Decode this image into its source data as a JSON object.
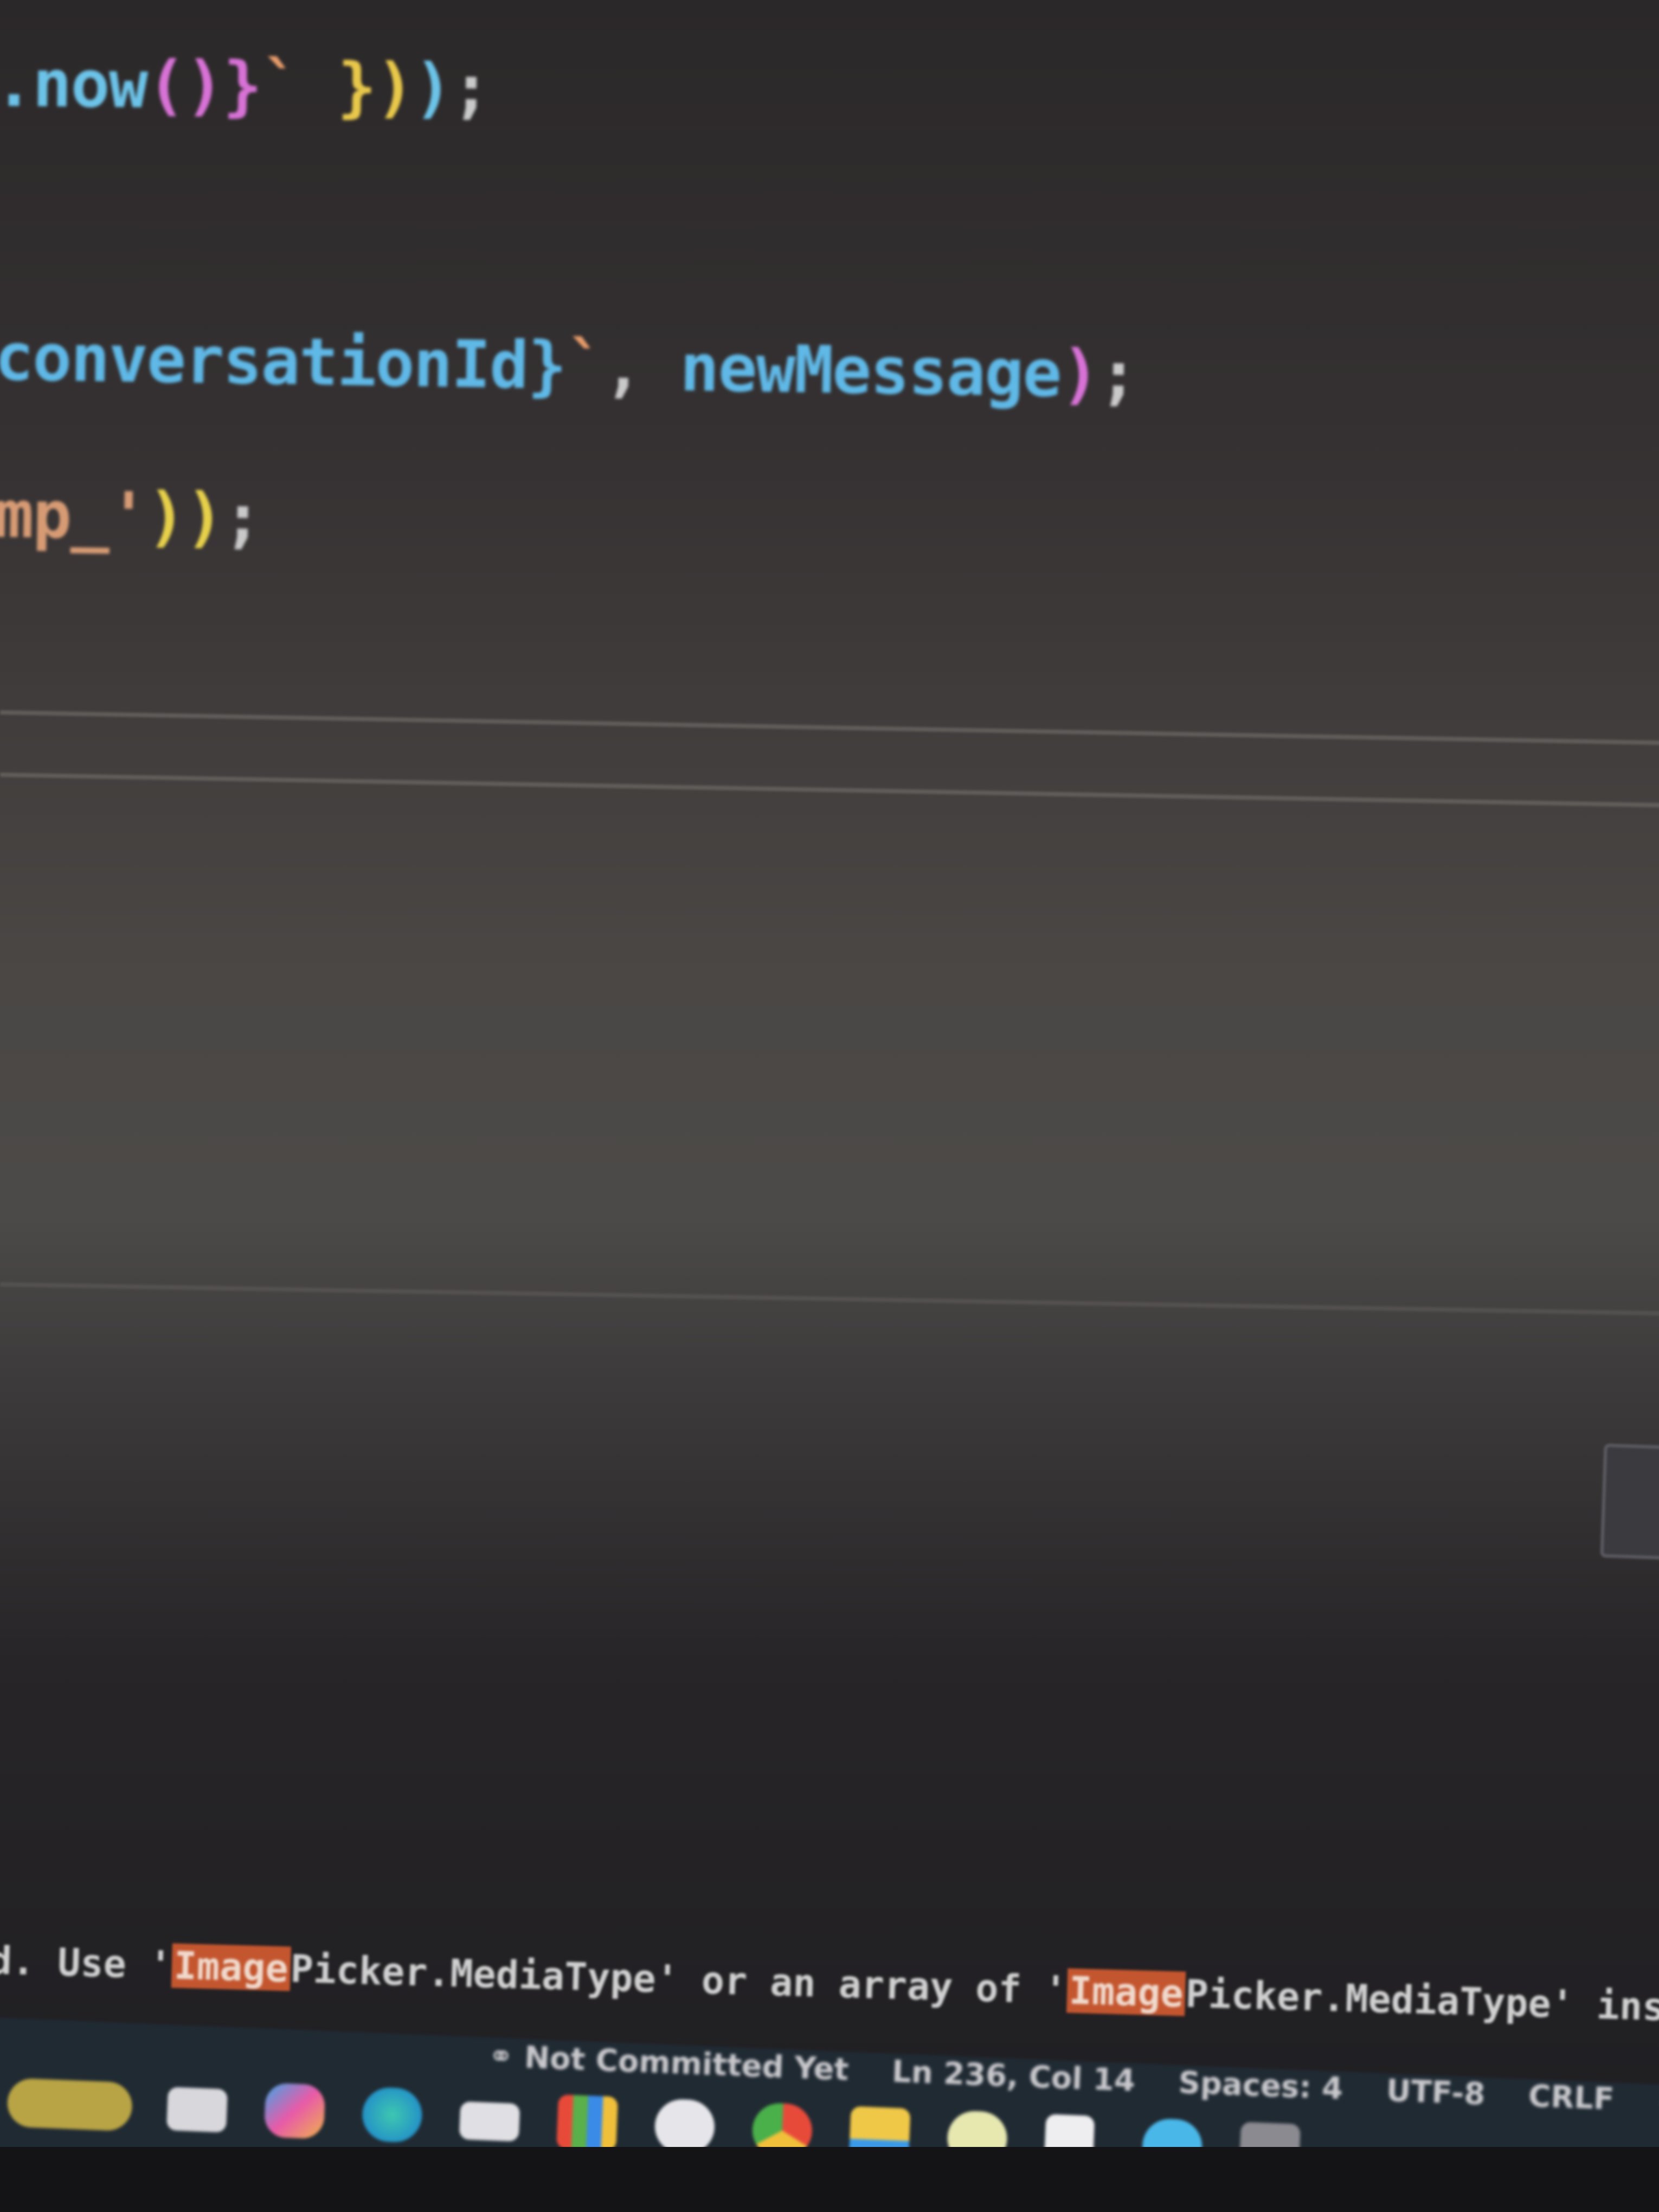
{
  "editor": {
    "line_1": {
      "method": ".now",
      "parens": "()",
      "brace": "}",
      "tpl_end": "`",
      "close_braces": " })",
      "close_paren": ")",
      "semicolon": ";"
    },
    "line_2": {
      "var": "conversationId",
      "brace": "}",
      "tpl_end": "`",
      "comma": ", ",
      "arg": "newMessage",
      "close_paren": ")",
      "semicolon": ";"
    },
    "line_3": {
      "str": "mp_",
      "quote": "'",
      "close_parens": "))",
      "semicolon": ";"
    }
  },
  "terminal": {
    "problem": {
      "prefix": "d. Use '",
      "hl_1": "Image",
      "part_1": "Picker.MediaType' or an array of '",
      "hl_2": "Image",
      "part_2": "Picker.MediaType' inste"
    }
  },
  "statusbar": {
    "git_icon": "git-commit-icon",
    "git_status": "Not Committed Yet",
    "cursor_position": "Ln 236, Col 14",
    "indentation": "Spaces: 4",
    "encoding": "UTF-8",
    "line_ending": "CRLF",
    "overflow": "{"
  },
  "taskbar": {
    "icons": [
      "weather-widget-icon",
      "task-view-icon",
      "copilot-icon",
      "edge-browser-icon",
      "teams-icon",
      "store-icon",
      "chat-icon",
      "chrome-icon",
      "file-explorer-icon",
      "notes-icon",
      "document-icon",
      "messaging-icon",
      "system-icon"
    ]
  },
  "colors": {
    "method": "#6cc3e8",
    "paren": "#d872d6",
    "brace": "#e8c84a",
    "string": "#d79b74",
    "highlight": "#c4562f"
  }
}
